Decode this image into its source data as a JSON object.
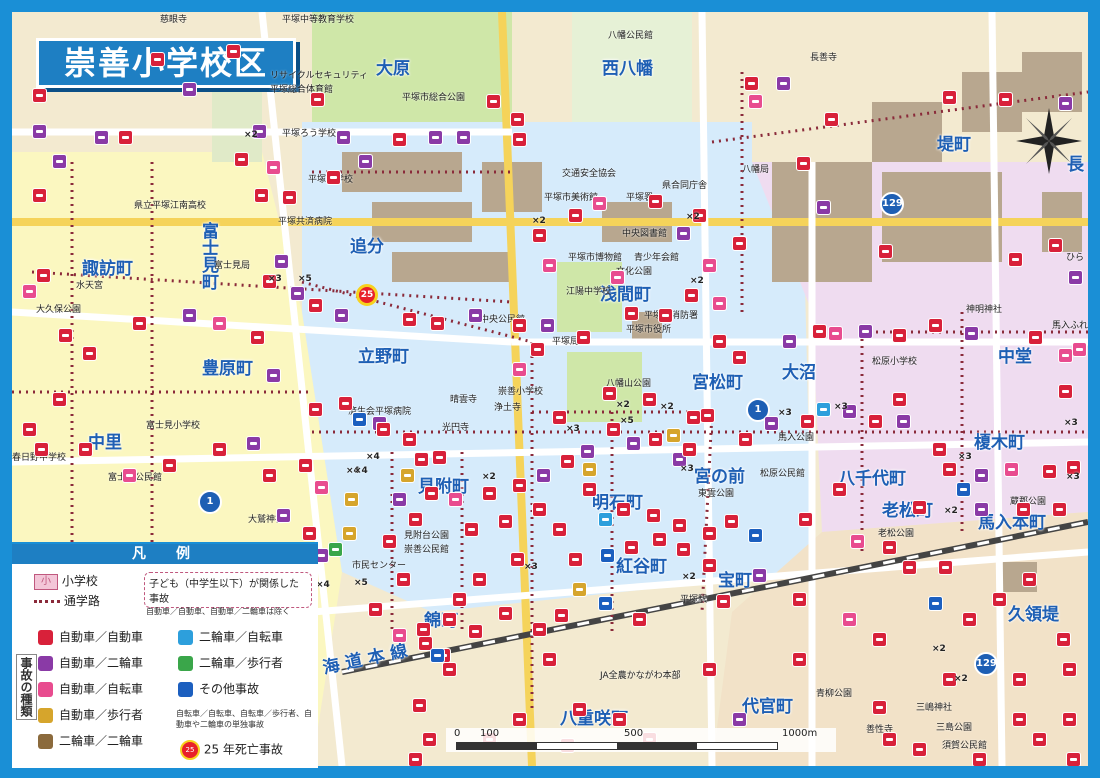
{
  "title": "崇善小学校区",
  "districts": [
    "大原",
    "西八幡",
    "堤町",
    "長",
    "追分",
    "富士見町",
    "諏訪町",
    "豊原町",
    "立野町",
    "浅間町",
    "宮松町",
    "大沼",
    "中堂",
    "榎木町",
    "中里",
    "見附町",
    "明石町",
    "宮の前",
    "八千代町",
    "老松町",
    "馬入本町",
    "紅谷町",
    "宝町",
    "錦町",
    "久領堤",
    "八重咲町",
    "代官町",
    "海道本線"
  ],
  "pois": [
    "慈眼寺",
    "平塚中等教育学校",
    "八幡公民館",
    "長善寺",
    "リサイクルセキュリティ",
    "平塚総合体育館",
    "平塚市総合公園",
    "平塚ろう学校",
    "平塚盲学校",
    "交通安全協会",
    "県合同庁舎",
    "平塚市美術館",
    "平塚署",
    "八幡局",
    "県立平塚江南高校",
    "平塚共済病院",
    "中央図書館",
    "富士見局",
    "平塚市博物館",
    "青少年会館",
    "文化公園",
    "水天宮",
    "江陽中学校",
    "大久保公園",
    "平塚市消防署",
    "神明神社",
    "中央公民館",
    "平塚局",
    "平塚市役所",
    "馬入ふれあい公園",
    "松原小学校",
    "八幡山公園",
    "崇善小学校",
    "晴雲寺",
    "浄土寺",
    "済生会平塚病院",
    "光円寺",
    "馬入公園",
    "富士見小学校",
    "春日野中学校",
    "富士見公民館",
    "松原公民館",
    "東雲公園",
    "大鷲神社",
    "蔵郡公園",
    "老松公園",
    "見附台公園",
    "崇善公民館",
    "市民センター",
    "平塚駅",
    "JA全農かながわ本部",
    "青柳公園",
    "三嶋神社",
    "善性寺",
    "三島公園",
    "須賀公民館",
    "ひら"
  ],
  "routes": [
    "129",
    "1",
    "129",
    "1"
  ],
  "legend": {
    "title": "凡　例",
    "school": "小学校",
    "school_mark": "小",
    "route": "通学路",
    "child": "子ども（中学生以下）が関係した事故",
    "child_note": "自動車／自動車、自動車／二輪車は除く",
    "side": "事故の種類",
    "types": [
      {
        "label": "自動車／自動車",
        "icon": "car-car-icon",
        "color": "#d8213a"
      },
      {
        "label": "自動車／二輪車",
        "icon": "car-moto-icon",
        "color": "#8a3aa6"
      },
      {
        "label": "自動車／自転車",
        "icon": "car-bike-icon",
        "color": "#e84c8f"
      },
      {
        "label": "自動車／歩行者",
        "icon": "car-ped-icon",
        "color": "#d6a52c"
      },
      {
        "label": "二輪車／二輪車",
        "icon": "moto-moto-icon",
        "color": "#8b6a3c"
      },
      {
        "label": "二輪車／自転車",
        "icon": "moto-bike-icon",
        "color": "#2d9fdc"
      },
      {
        "label": "二輪車／歩行者",
        "icon": "moto-ped-icon",
        "color": "#3aa64a"
      },
      {
        "label": "その他事故",
        "icon": "other-accident-icon",
        "color": "#1c5fbf"
      }
    ],
    "other_note": "自転車／自転車、自転車／歩行者、自動車や二輪車の単独事故",
    "fatal": "25 年死亡事故",
    "fatal_mark": "25"
  },
  "scale": {
    "ticks": [
      "0",
      "100",
      "500",
      "1000m"
    ]
  },
  "fatal_marker": "25",
  "multipliers": [
    "×2",
    "×3",
    "×4",
    "×5"
  ],
  "colors": {
    "frame": "#1a8fd6",
    "school_zone": "#d6ebfb",
    "north_zone": "#fbf7c0",
    "east_zone": "#efdcf0",
    "route_dots": "#8a2a3a"
  }
}
